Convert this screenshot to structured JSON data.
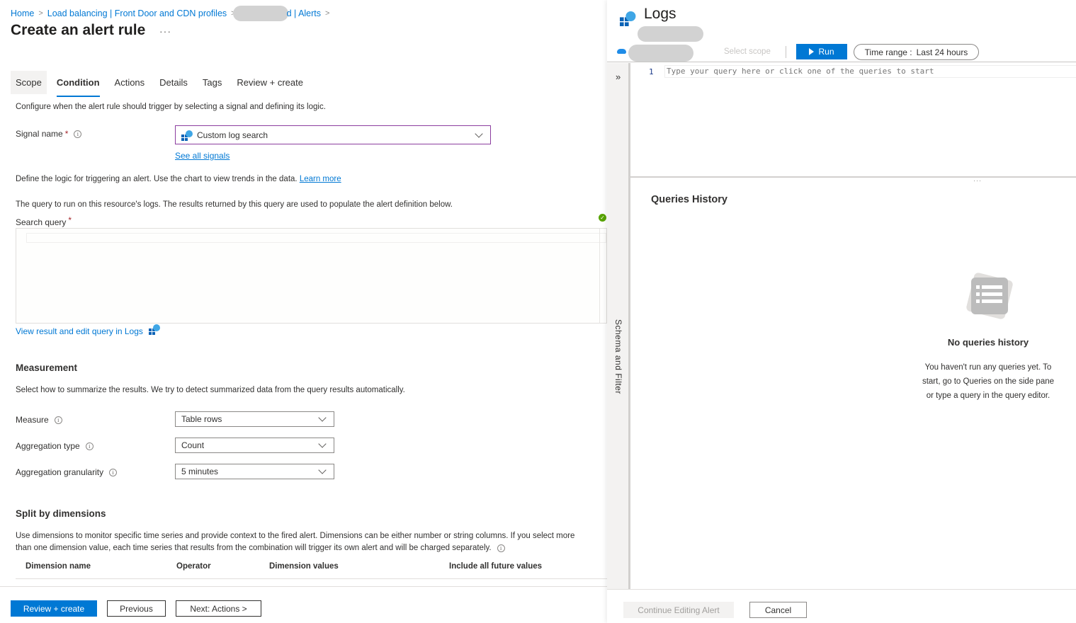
{
  "breadcrumb": {
    "items": [
      "Home",
      "Load balancing | Front Door and CDN profiles",
      "d | Alerts"
    ]
  },
  "page": {
    "title": "Create an alert rule",
    "more": "···"
  },
  "tabs": [
    {
      "label": "Scope"
    },
    {
      "label": "Condition",
      "active": true
    },
    {
      "label": "Actions"
    },
    {
      "label": "Details"
    },
    {
      "label": "Tags"
    },
    {
      "label": "Review + create"
    }
  ],
  "condition": {
    "intro": "Configure when the alert rule should trigger by selecting a signal and defining its logic.",
    "signal_label": "Signal name",
    "signal_value": "Custom log search",
    "see_all_signals": "See all signals",
    "logic_text": "Define the logic for triggering an alert. Use the chart to view trends in the data.",
    "learn_more": "Learn more",
    "query_desc": "The query to run on this resource's logs. The results returned by this query are used to populate the alert definition below.",
    "search_query_label": "Search query",
    "required_mark": "*",
    "search_query_value": "",
    "view_in_logs": "View result and edit query in Logs"
  },
  "measurement": {
    "title": "Measurement",
    "desc": "Select how to summarize the results. We try to detect summarized data from the query results automatically.",
    "fields": [
      {
        "label": "Measure",
        "value": "Table rows"
      },
      {
        "label": "Aggregation type",
        "value": "Count"
      },
      {
        "label": "Aggregation granularity",
        "value": "5 minutes"
      }
    ]
  },
  "split": {
    "title": "Split by dimensions",
    "desc_line1": "Use dimensions to monitor specific time series and provide context to the fired alert. Dimensions can be either number or string columns. If you select more",
    "desc_line2": "than one dimension value, each time series that results from the combination will trigger its own alert and will be charged separately.",
    "columns": [
      "Dimension name",
      "Operator",
      "Dimension values",
      "Include all future values"
    ]
  },
  "footer_left": {
    "review_create": "Review + create",
    "previous": "Previous",
    "next": "Next: Actions >"
  },
  "logs": {
    "title": "Logs",
    "select_scope": "Select scope",
    "run": "Run",
    "time_range_label": "Time range :",
    "time_range_value": "Last 24 hours",
    "line_number": "1",
    "editor_placeholder": "Type your query here or click one of the queries to start",
    "schema_filter": "Schema and Filter",
    "history_title": "Queries History",
    "empty_title": "No queries history",
    "empty_desc": "You haven't run any queries yet. To start, go to Queries on the side pane or type a query in the query editor.",
    "continue_editing": "Continue Editing Alert",
    "cancel": "Cancel"
  },
  "colors": {
    "accent": "#0078d4",
    "signal_border": "#8b3d9f",
    "success": "#57a300",
    "required": "#a4262c"
  }
}
